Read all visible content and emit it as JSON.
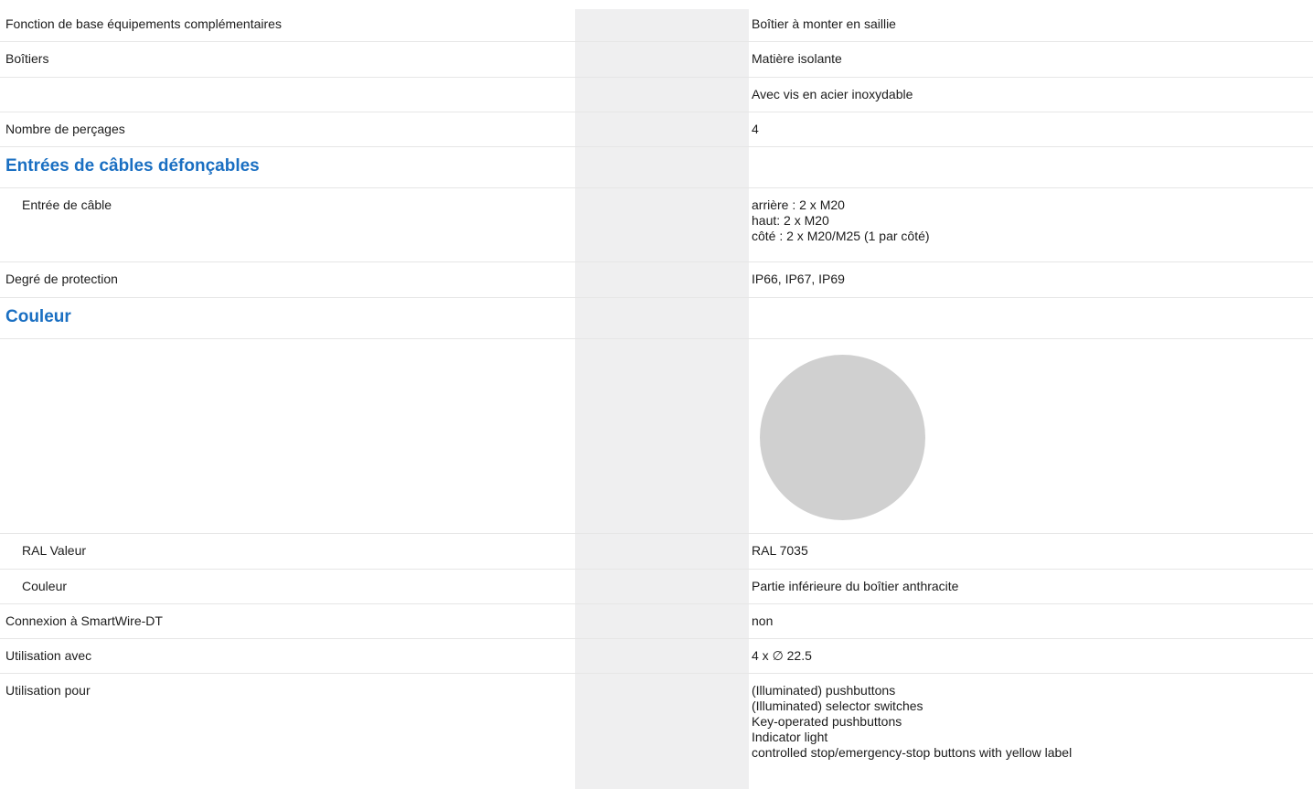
{
  "rows": {
    "r1": {
      "label": "Fonction de base équipements complémentaires",
      "value": "Boîtier à monter en saillie"
    },
    "r2": {
      "label": "Boîtiers",
      "value": "Matière isolante"
    },
    "r3": {
      "label": "",
      "value": "Avec vis en acier inoxydable"
    },
    "r4": {
      "label": "Nombre de perçages",
      "value": "4"
    },
    "s1": {
      "title": "Entrées de câbles défonçables"
    },
    "r5": {
      "label": "Entrée de câble",
      "lines": [
        "arrière : 2 x M20",
        "haut: 2 x M20",
        "côté : 2 x M20/M25 (1 par côté)"
      ]
    },
    "r6": {
      "label": "Degré de protection",
      "value": "IP66, IP67, IP69"
    },
    "s2": {
      "title": "Couleur"
    },
    "swatch": {
      "color": "#d0d0d0",
      "name": "color-swatch"
    },
    "r7": {
      "label": "RAL Valeur",
      "value": "RAL 7035"
    },
    "r8": {
      "label": "Couleur",
      "value": "Partie inférieure du boîtier anthracite"
    },
    "r9": {
      "label": "Connexion à SmartWire-DT",
      "value": "non"
    },
    "r10": {
      "label": "Utilisation avec",
      "value": "4 x ∅ 22.5"
    },
    "r11": {
      "label": "Utilisation pour",
      "lines": [
        "(Illuminated) pushbuttons",
        "(Illuminated) selector switches",
        "Key-operated pushbuttons",
        "Indicator light",
        "controlled stop/emergency-stop buttons with yellow label"
      ]
    }
  },
  "colors": {
    "section_title": "#1a6fc2",
    "band": "#efeff0",
    "divider": "#e6e6e6",
    "text": "#1c1c1c"
  }
}
